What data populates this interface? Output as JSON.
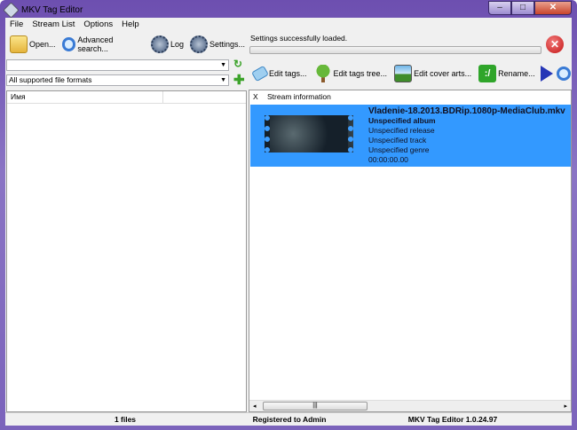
{
  "window": {
    "title": "MKV Tag Editor",
    "min": "–",
    "max": "□",
    "close": "✕"
  },
  "menu": [
    "File",
    "Stream List",
    "Options",
    "Help"
  ],
  "toolbar": {
    "open": "Open...",
    "advanced_search": "Advanced search...",
    "log": "Log",
    "settings": "Settings..."
  },
  "left": {
    "path_value": "",
    "format_filter": "All supported file formats",
    "column_header": "Имя"
  },
  "right": {
    "status": "Settings successfully loaded.",
    "progress": 0,
    "toolbar": {
      "edit_tags": "Edit tags...",
      "edit_tags_tree": "Edit tags tree...",
      "edit_cover_arts": "Edit cover arts...",
      "rename": "Rename..."
    },
    "columns": [
      "X",
      "Stream information"
    ],
    "item": {
      "filename": "Vladenie-18.2013.BDRip.1080p-MediaClub.mkv",
      "album": "Unspecified album",
      "release": "Unspecified release",
      "track": "Unspecified track",
      "genre": "Unspecified genre",
      "duration": "00:00:00.00"
    }
  },
  "statusbar": {
    "files": "1 files",
    "registered": "Registered to Admin",
    "version": "MKV Tag Editor 1.0.24.97"
  }
}
